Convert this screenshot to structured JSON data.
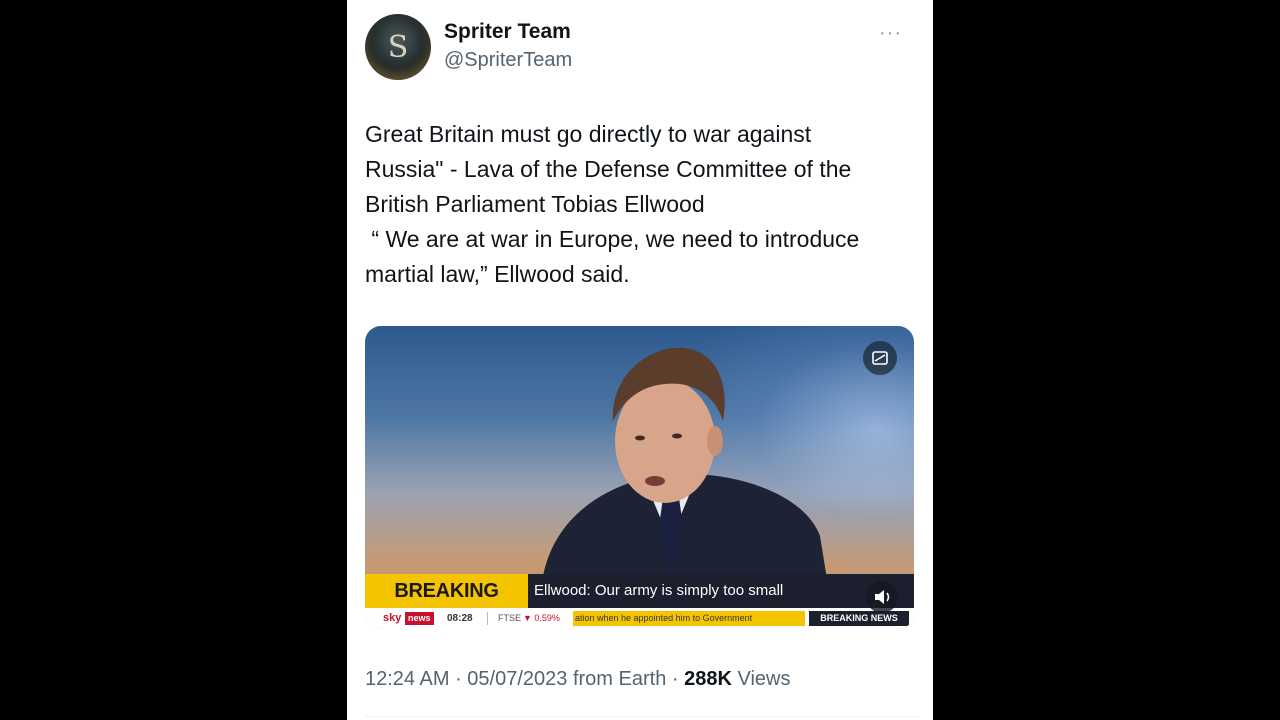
{
  "tweet": {
    "author_name": "Spriter Team",
    "author_handle": "@SpriterTeam",
    "avatar_letter": "S",
    "more_label": "···",
    "text": "Great Britain must go directly to war against\nRussia\" - Lava of the Defense Committee of the\nBritish Parliament Tobias Ellwood\n “ We are at war in Europe, we need to introduce\nmartial law,” Ellwood said.",
    "meta": {
      "time": "12:24 AM",
      "separator1": " · ",
      "date": "05/07/2023",
      "source": " from Earth",
      "separator2": " · ",
      "views_count": "288K",
      "views_label": " Views"
    }
  },
  "video": {
    "icons": {
      "expand": "expand-icon",
      "volume": "volume-icon"
    },
    "lower_third": {
      "label": "BREAKING NEWS",
      "headline": "Ellwood: Our army is simply too small"
    },
    "ticker": {
      "logo_sky": "sky",
      "logo_news": "news",
      "time": "08:28",
      "ftse_label": "FTSE",
      "ftse_value": "▼ 0.59%",
      "scroll_text": "ation when he appointed him to Government",
      "breaking_label": "BREAKING NEWS"
    }
  },
  "colors": {
    "breaking_yellow": "#f5c400",
    "sky_red": "#c8102e",
    "text_primary": "#0f1419",
    "text_secondary": "#536471"
  }
}
